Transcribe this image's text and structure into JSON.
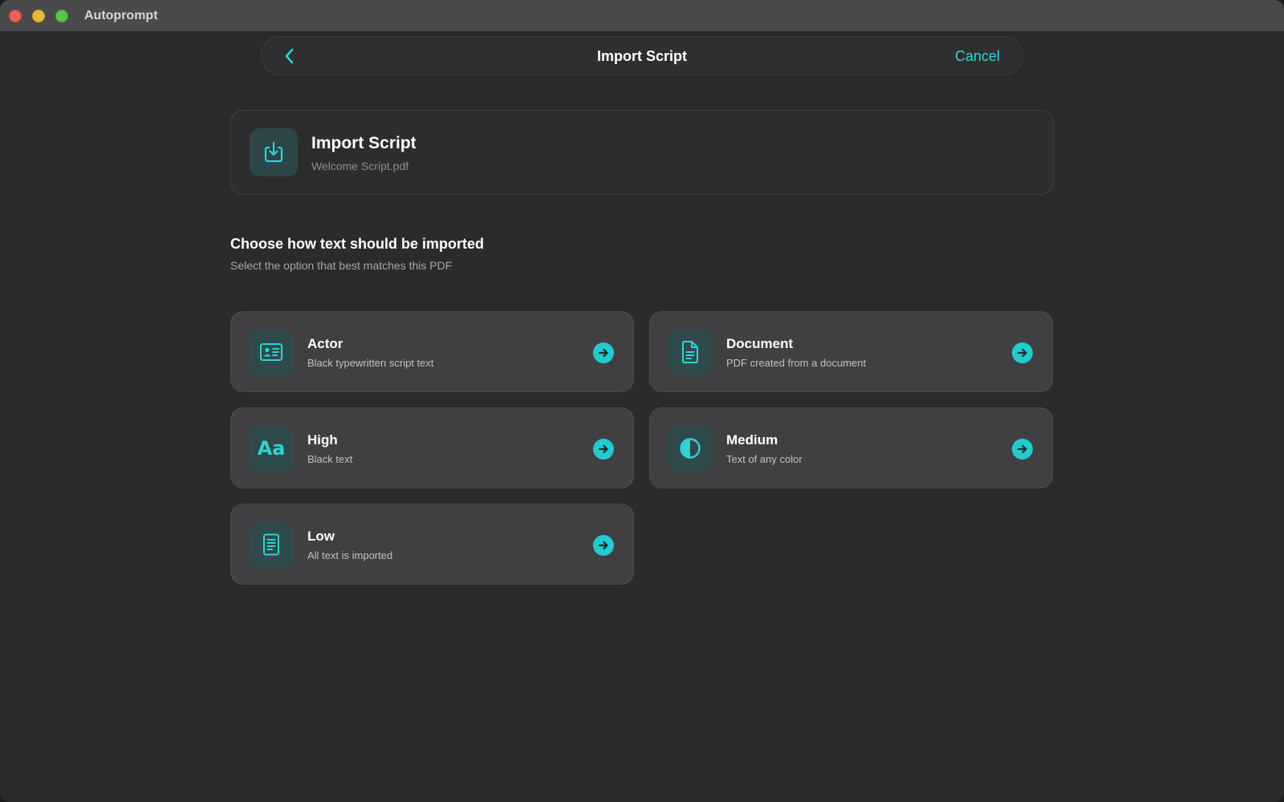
{
  "window": {
    "app_title": "Autoprompt"
  },
  "navbar": {
    "title": "Import Script",
    "cancel_label": "Cancel",
    "back_icon": "chevron-left-icon"
  },
  "script": {
    "title": "Import Script",
    "filename": "Welcome Script.pdf",
    "icon": "import-icon"
  },
  "section": {
    "heading": "Choose how text should be imported",
    "subheading": "Select the option that best matches this PDF"
  },
  "options": [
    {
      "title": "Actor",
      "description": "Black typewritten script text",
      "icon": "id-card-icon"
    },
    {
      "title": "Document",
      "description": "PDF created from a document",
      "icon": "document-icon"
    },
    {
      "title": "High",
      "description": "Black text",
      "icon": "text-format-icon",
      "glyph": "Aa"
    },
    {
      "title": "Medium",
      "description": "Text of any color",
      "icon": "contrast-icon"
    },
    {
      "title": "Low",
      "description": "All text is imported",
      "icon": "page-icon"
    }
  ],
  "colors": {
    "accent": "#2ed3d3",
    "background": "#2b2b2d",
    "card": "#404042",
    "titlebar": "#4a4a4c"
  }
}
